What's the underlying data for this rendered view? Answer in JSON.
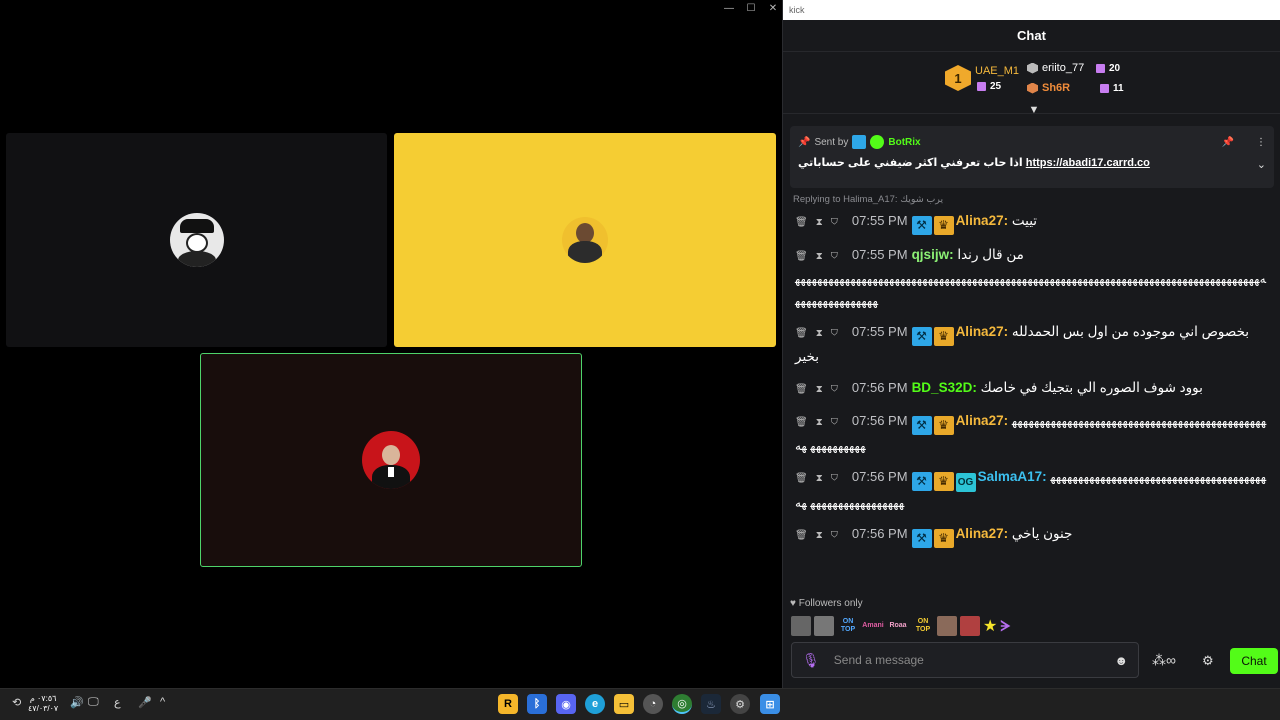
{
  "chat_window": {
    "app_title": "kick",
    "header_title": "Chat",
    "leaderboard": {
      "rank1": {
        "rank": "1",
        "name": "UAE_M1",
        "count": "25"
      },
      "rank2": {
        "name": "eriito_77",
        "count": "20"
      },
      "rank3": {
        "name": "Sh6R",
        "count": "11"
      }
    },
    "pinned": {
      "sent_by_label": "Sent by",
      "sender": "BotRix",
      "text_ar": "اذا حاب تعرفني اكثر ضيفني على حساباتي",
      "link": "https://abadi17.carrd.co"
    },
    "reply_context": "Replying to Halima_A17: يرب شويك",
    "messages": [
      {
        "time": "07:55 PM",
        "user": "Alina27:",
        "user_color": "#f5b93d",
        "badges": [
          "mod",
          "vip"
        ],
        "text": "تييت"
      },
      {
        "time": "07:55 PM",
        "user": "qjsijw:",
        "user_color": "#8cf075",
        "badges": [],
        "text": "من قال رندا",
        "extra": "ﻪﻬﻬﻬﻬﻬﻬﻬﻬﻬﻬﻬﻬﻬﻬﻬﻬﻬﻬﻬﻬﻬﻬﻬﻬﻬﻬﻬﻬﻬﻬﻬﻬﻬﻬﻬﻬﻬﻬﻬﻬﻬﻬﻬﻬﻬﻬﻬﻬﻬﻬﻬﻬﻬﻬﻬﻬﻬﻬﻬﻬﻬﻬﻬﻬﻬﻬﻬﻬﻬﻬﻬﻬﻬﻬﻬﻬﻬﻬﻬﻬﻬﻬﻬﻬﻬﻬﻬﻬﻬﻬﻬﻬﻬﻬﻬﻬﻬﻬﻬ"
      },
      {
        "time": "07:55 PM",
        "user": "Alina27:",
        "user_color": "#f5b93d",
        "badges": [
          "mod",
          "vip"
        ],
        "text": "بخصوص اني موجوده من اول بس الحمدلله بخير"
      },
      {
        "time": "07:56 PM",
        "user": "BD_S32D:",
        "user_color": "#53fc18",
        "badges": [],
        "text": "بوود شوف الصوره الي بتجيك في خاصك"
      },
      {
        "time": "07:56 PM",
        "user": "Alina27:",
        "user_color": "#f5b93d",
        "badges": [
          "mod",
          "vip"
        ],
        "text": "ﻬﻬﻬﻬﻬﻬﻬﻬﻬﻬﻬﻬﻬﻬﻬﻬﻬﻬﻬﻬﻬﻬﻬﻬﻬﻬﻬﻬﻬﻬﻬﻬﻬﻬﻬﻬﻬﻬﻬﻬﻬﻬﻬﻬﻬﻬﻬﻬﻬﻬﻬﻬﻬﻬﻬﻬ ﻬﻪ"
      },
      {
        "time": "07:56 PM",
        "user": "SalmaA17:",
        "user_color": "#3cc0ef",
        "badges": [
          "mod",
          "vip",
          "og"
        ],
        "text": "ﻬﻬﻬﻬﻬﻬﻬﻬﻬﻬﻬﻬﻬﻬﻬﻬﻬﻬﻬﻬﻬﻬﻬﻬﻬﻬﻬﻬﻬﻬﻬﻬﻬﻬﻬﻬﻬﻬﻬﻬﻬﻬﻬﻬﻬﻬﻬﻬﻬﻬﻬﻬﻬﻬﻬﻬ ﻬﻪ"
      },
      {
        "time": "07:56 PM",
        "user": "Alina27:",
        "user_color": "#f5b93d",
        "badges": [
          "mod",
          "vip"
        ],
        "text": "جنون ياخي"
      }
    ],
    "followers_only": "Followers only",
    "emotes": [
      "ON TOP",
      "Amani",
      "Roaa",
      "ON TOP"
    ],
    "input_placeholder": "Send a message",
    "chat_button": "Chat"
  },
  "taskbar": {
    "clock_time": "٠٧:٥٦ م",
    "clock_date": "٤٧/٠٣/٠٧",
    "lang": "ع"
  },
  "colors": {
    "kick_green": "#53fc18",
    "tile_yellow": "#f5cd33",
    "panel_bg": "#18191c"
  }
}
